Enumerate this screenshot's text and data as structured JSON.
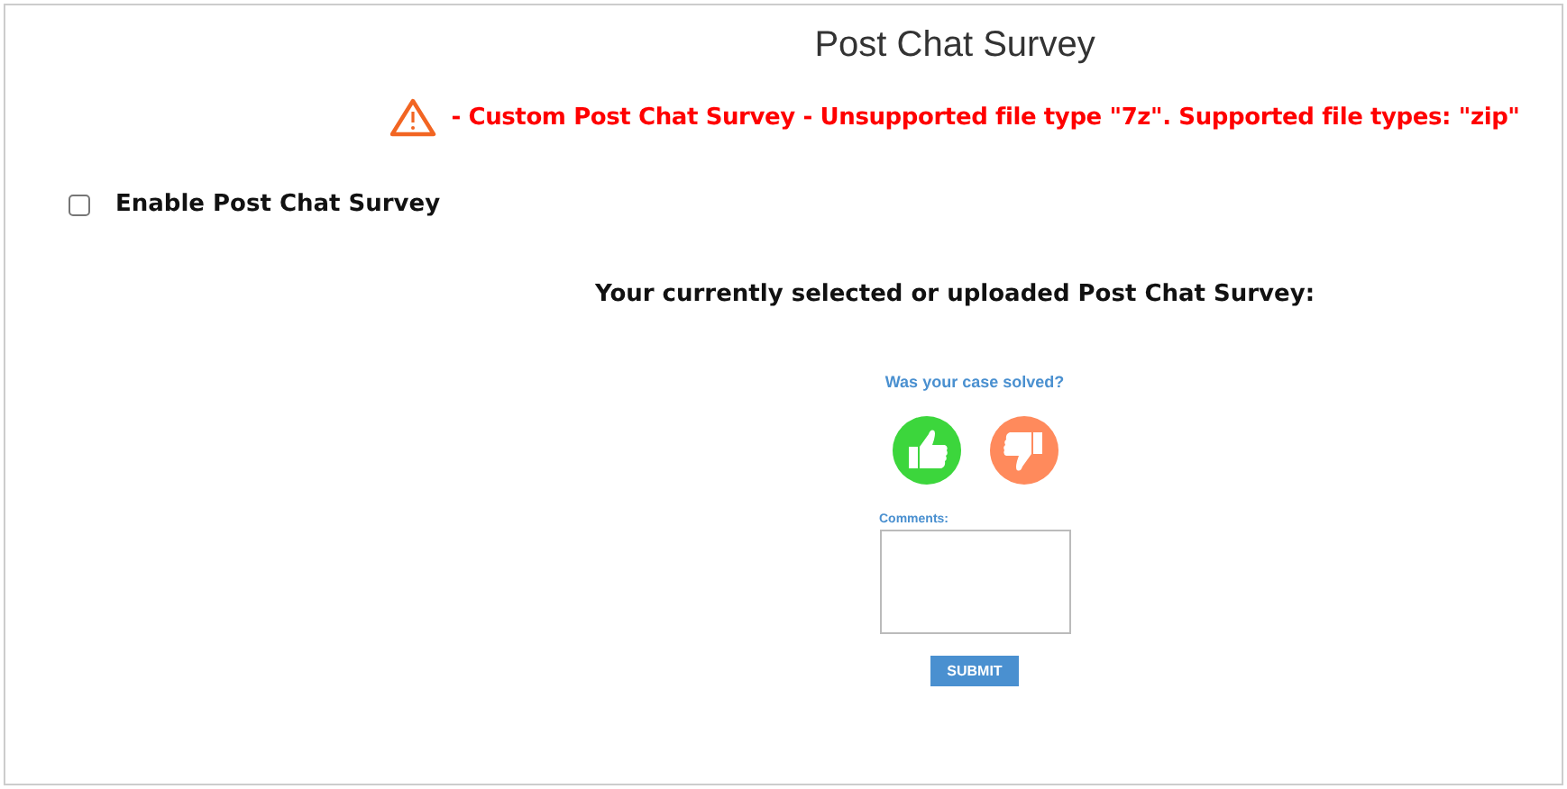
{
  "title": "Post Chat Survey",
  "error": "- Custom Post Chat Survey - Unsupported file type \"7z\". Supported file types: \"zip\"",
  "enable": {
    "label": "Enable Post Chat Survey",
    "checked": false
  },
  "current_label": "Your currently selected or uploaded Post Chat Survey:",
  "survey": {
    "question": "Was your case solved?",
    "comments_label": "Comments:",
    "submit": "SUBMIT"
  }
}
